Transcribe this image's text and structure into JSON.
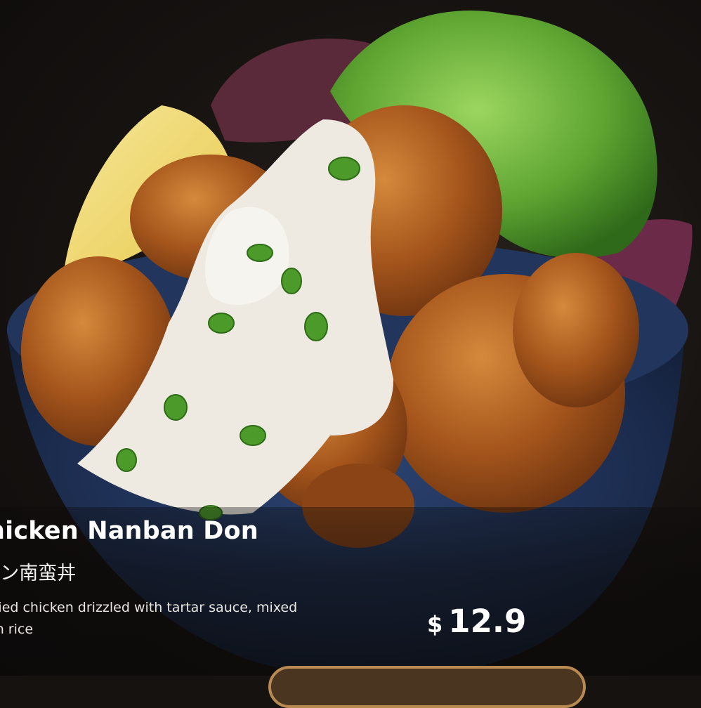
{
  "item": {
    "title": "hicken Nanban Don",
    "subtitle": "キン南蛮丼",
    "description": "p-fried chicken drizzled with tartar sauce, mixed d on rice",
    "description_line1": "p-fried chicken drizzled with tartar sauce, mixed",
    "description_line2": "d on rice",
    "price_currency": "$",
    "price_value": "12.9"
  },
  "colors": {
    "background": "#151210",
    "bowl": "#1f3256",
    "button_border": "#b88950"
  }
}
